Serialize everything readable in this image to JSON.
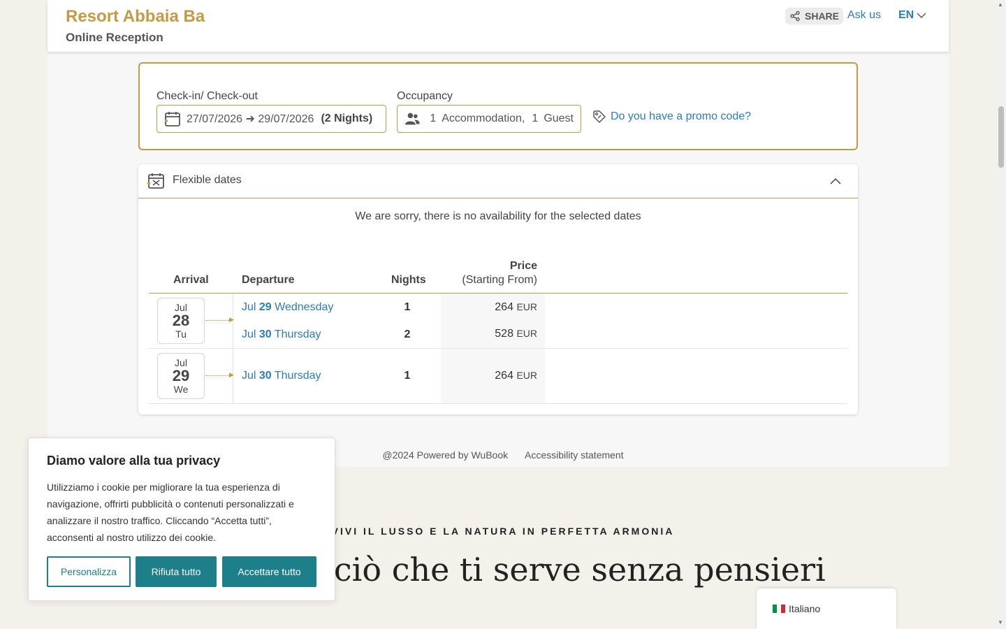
{
  "header": {
    "brand": "Resort Abbaia Ba",
    "subtitle": "Online Reception",
    "share_label": "SHARE",
    "ask_us": "Ask us",
    "language": "EN"
  },
  "search": {
    "checkin_label": "Check-in/ Check-out",
    "dates": "27/07/2026 ➜ 29/07/2026",
    "nights": "(2 Nights)",
    "occupancy_label": "Occupancy",
    "accommodations_count": "1",
    "accommodations_label": "Accommodation,",
    "guests_count": "1",
    "guests_label": "Guest",
    "promo": "Do you have a promo code?"
  },
  "flexible": {
    "title": "Flexible dates",
    "message": "We are sorry, there is no availability for the selected dates",
    "columns": {
      "arrival": "Arrival",
      "departure": "Departure",
      "nights": "Nights",
      "price": "Price",
      "price_sub": "(Starting From)"
    },
    "groups": [
      {
        "arrival": {
          "month": "Jul",
          "day": "28",
          "weekday": "Tu"
        },
        "options": [
          {
            "month": "Jul",
            "day": "29",
            "weekday": "Wednesday",
            "nights": "1",
            "price": "264",
            "currency": "EUR"
          },
          {
            "month": "Jul",
            "day": "30",
            "weekday": "Thursday",
            "nights": "2",
            "price": "528",
            "currency": "EUR"
          }
        ]
      },
      {
        "arrival": {
          "month": "Jul",
          "day": "29",
          "weekday": "We"
        },
        "options": [
          {
            "month": "Jul",
            "day": "30",
            "weekday": "Thursday",
            "nights": "1",
            "price": "264",
            "currency": "EUR"
          }
        ]
      }
    ]
  },
  "footer": {
    "powered": "@2024 Powered by WuBook",
    "accessibility": "Accessibility statement"
  },
  "site": {
    "tagline": "VIVI IL LUSSO E LA NATURA IN PERFETTA ARMONIA",
    "hero": "Tutto ciò che ti serve senza pensieri"
  },
  "cookie": {
    "title": "Diamo valore alla tua privacy",
    "text": "Utilizziamo i cookie per migliorare la tua esperienza di navigazione, offrirti pubblicità o contenuti personalizzati e analizzare il nostro traffico. Cliccando “Accetta tutti”, acconsenti al nostro utilizzo dei cookie.",
    "customize": "Personalizza",
    "reject": "Rifiuta tutto",
    "accept": "Accettare tutto"
  },
  "language_widget": {
    "label": "Italiano"
  },
  "colors": {
    "accent": "#c49a45",
    "link": "#2b7bbd",
    "cookie_button": "#1d7f8a"
  }
}
